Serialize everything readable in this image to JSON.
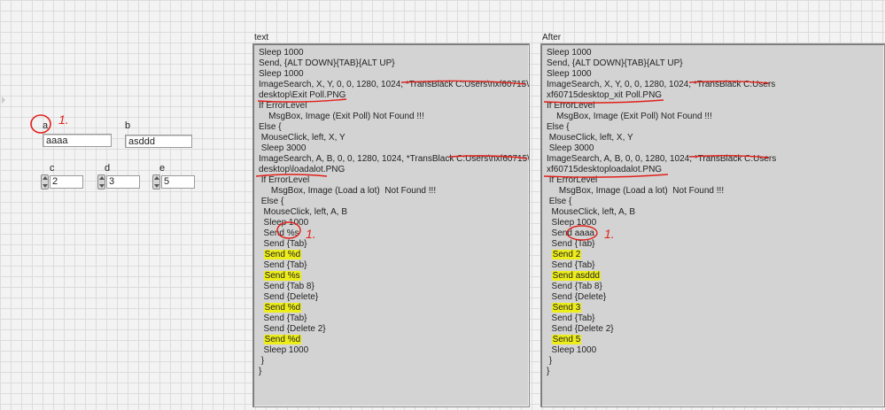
{
  "controls": {
    "a": {
      "label": "a",
      "value": "aaaa"
    },
    "b": {
      "label": "b",
      "value": "asddd"
    },
    "c": {
      "label": "c",
      "value": "2"
    },
    "d": {
      "label": "d",
      "value": "3"
    },
    "e": {
      "label": "e",
      "value": "5"
    }
  },
  "annotation_mark": "1.",
  "text_panel": {
    "title": "text",
    "lines": [
      "Sleep 1000",
      "Send, {ALT DOWN}{TAB}{ALT UP}",
      "Sleep 1000",
      "ImageSearch, X, Y, 0, 0, 1280, 1024, *TransBlack C:Users\\nxf60715\\",
      "desktop\\Exit Poll.PNG",
      "If ErrorLevel",
      "    MsgBox, Image (Exit Poll) Not Found !!!",
      "Else {",
      " MouseClick, left, X, Y",
      " Sleep 3000",
      "ImageSearch, A, B, 0, 0, 1280, 1024, *TransBlack C:Users\\nxf60715\\",
      "desktop\\loadalot.PNG",
      " If ErrorLevel",
      "     MsgBox, Image (Load a lot)  Not Found !!!",
      " Else {",
      "  MouseClick, left, A, B",
      "  Sleep 1000",
      "  Send %s",
      "  Send {Tab}",
      "  Send %d",
      "  Send {Tab}",
      "  Send %s",
      "  Send {Tab 8}",
      "  Send {Delete}",
      "  Send %d",
      "  Send {Tab}",
      "  Send {Delete 2}",
      "  Send %d",
      "  Sleep 1000",
      " }",
      "}"
    ]
  },
  "after_panel": {
    "title": "After",
    "lines": [
      "Sleep 1000",
      "Send, {ALT DOWN}{TAB}{ALT UP}",
      "Sleep 1000",
      "ImageSearch, X, Y, 0, 0, 1280, 1024, *TransBlack C:Users",
      "xf60715desktop_xit Poll.PNG",
      "If ErrorLevel",
      "    MsgBox, Image (Exit Poll) Not Found !!!",
      "Else {",
      " MouseClick, left, X, Y",
      " Sleep 3000",
      "ImageSearch, A, B, 0, 0, 1280, 1024, *TransBlack C:Users",
      "xf60715desktoploadalot.PNG",
      " If ErrorLevel",
      "     MsgBox, Image (Load a lot)  Not Found !!!",
      " Else {",
      "  MouseClick, left, A, B",
      "  Sleep 1000",
      "  Send aaaa",
      "  Send {Tab}",
      "  Send 2",
      "  Send {Tab}",
      "  Send asddd",
      "  Send {Tab 8}",
      "  Send {Delete}",
      "  Send 3",
      "  Send {Tab}",
      "  Send {Delete 2}",
      "  Send 5",
      "  Sleep 1000",
      " }",
      "}"
    ]
  },
  "highlight_color": "#eded1b",
  "annotation_color": "#e0201a"
}
